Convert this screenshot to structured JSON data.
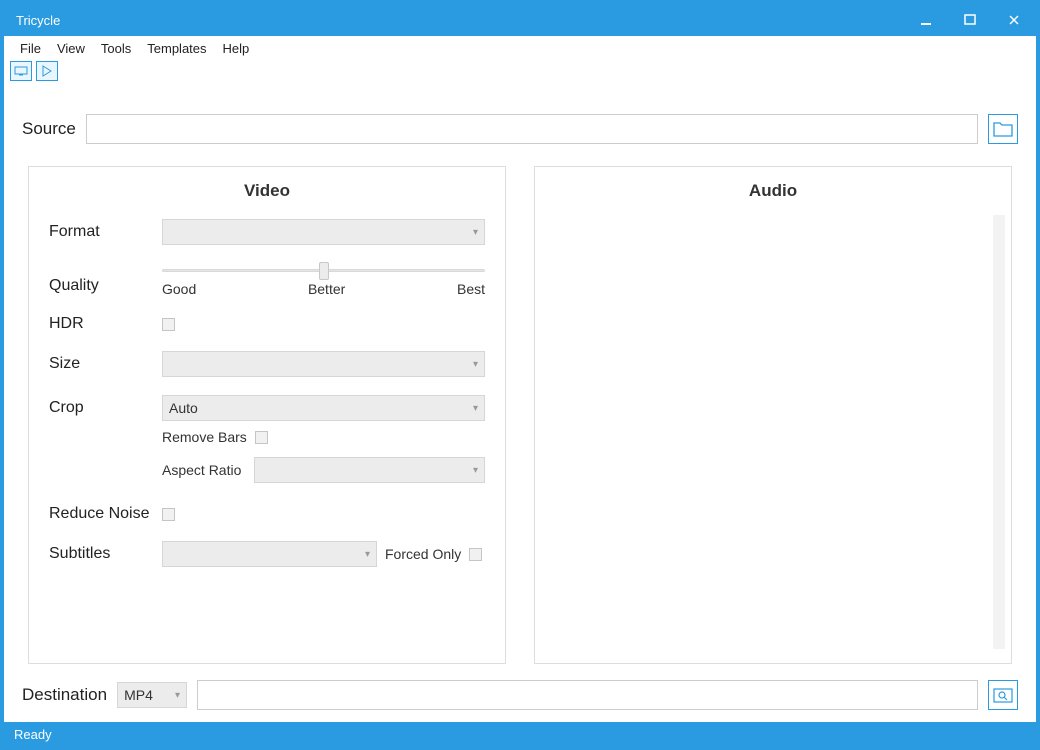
{
  "window": {
    "title": "Tricycle"
  },
  "menubar": {
    "items": [
      "File",
      "View",
      "Tools",
      "Templates",
      "Help"
    ]
  },
  "source": {
    "label": "Source",
    "value": ""
  },
  "video": {
    "title": "Video",
    "format_label": "Format",
    "format_value": "",
    "quality_label": "Quality",
    "quality_ticks": {
      "good": "Good",
      "better": "Better",
      "best": "Best"
    },
    "hdr_label": "HDR",
    "size_label": "Size",
    "size_value": "",
    "crop_label": "Crop",
    "crop_value": "Auto",
    "remove_bars_label": "Remove Bars",
    "aspect_label": "Aspect Ratio",
    "aspect_value": "",
    "reduce_noise_label": "Reduce Noise",
    "subtitles_label": "Subtitles",
    "subtitles_value": "",
    "forced_only_label": "Forced Only"
  },
  "audio": {
    "title": "Audio"
  },
  "destination": {
    "label": "Destination",
    "container_value": "MP4",
    "path_value": ""
  },
  "status": {
    "text": "Ready"
  }
}
